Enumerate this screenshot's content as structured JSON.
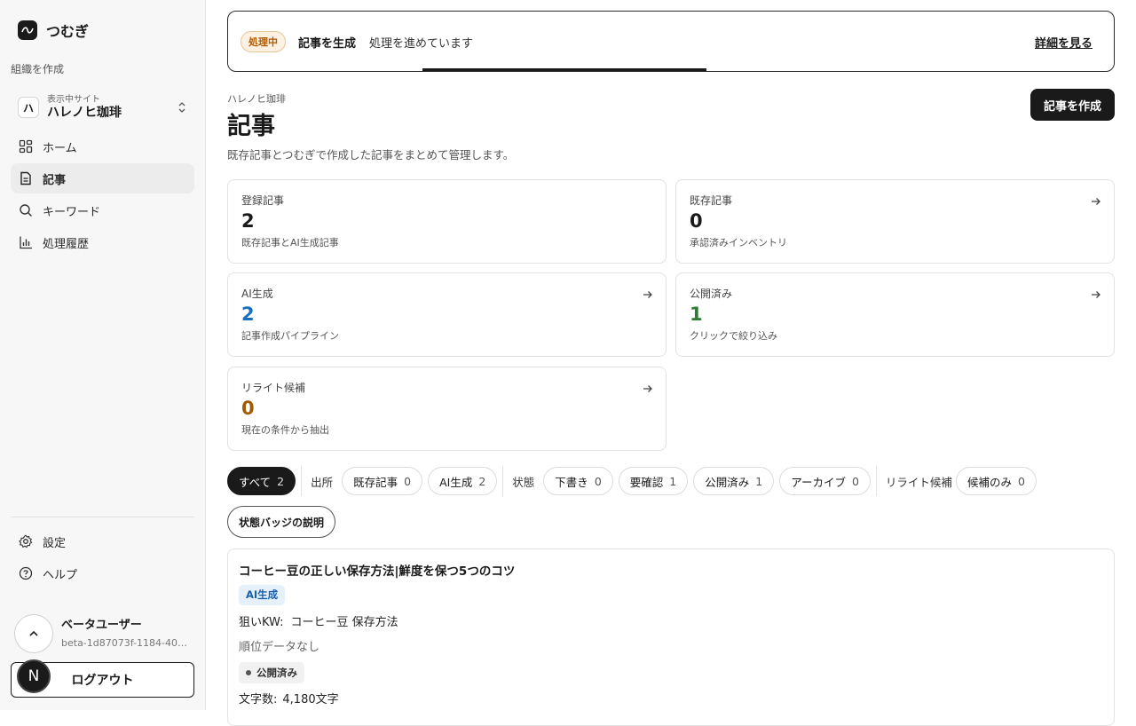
{
  "app": {
    "name": "つむぎ"
  },
  "sidebar": {
    "org_create": "組織を作成",
    "site": {
      "initial": "ハ",
      "sub": "表示中サイト",
      "name": "ハレノヒ珈琲"
    },
    "nav": [
      {
        "label": "ホーム",
        "icon": "grid-icon",
        "active": false
      },
      {
        "label": "記事",
        "icon": "document-icon",
        "active": true
      },
      {
        "label": "キーワード",
        "icon": "search-icon",
        "active": false
      },
      {
        "label": "処理履歴",
        "icon": "chart-icon",
        "active": false
      }
    ],
    "bottom": [
      {
        "label": "設定",
        "icon": "gear-icon"
      },
      {
        "label": "ヘルプ",
        "icon": "help-icon"
      }
    ],
    "user": {
      "name": "ベータユーザー",
      "id": "beta-1d87073f-1184-401...",
      "avatar": "N"
    },
    "logout": "ログアウト"
  },
  "banner": {
    "status": "処理中",
    "title": "記事を生成",
    "message": "処理を進めています",
    "link": "詳細を見る"
  },
  "header": {
    "breadcrumb": "ハレノヒ珈琲",
    "title": "記事",
    "description": "既存記事とつむぎで作成した記事をまとめて管理します。",
    "create_button": "記事を作成"
  },
  "stats": [
    {
      "label": "登録記事",
      "value": "2",
      "desc": "既存記事とAI生成記事",
      "color": "#1a1a1a",
      "arrow": false
    },
    {
      "label": "既存記事",
      "value": "0",
      "desc": "承認済みインベントリ",
      "color": "#1a1a1a",
      "arrow": true
    },
    {
      "label": "AI生成",
      "value": "2",
      "desc": "記事作成パイプライン",
      "color": "#1b6fbf",
      "arrow": true
    },
    {
      "label": "公開済み",
      "value": "1",
      "desc": "クリックで絞り込み",
      "color": "#2e7d32",
      "arrow": true
    },
    {
      "label": "リライト候補",
      "value": "0",
      "desc": "現在の条件から抽出",
      "color": "#a05c00",
      "arrow": true
    }
  ],
  "filters": {
    "all": {
      "label": "すべて",
      "count": "2"
    },
    "source_label": "出所",
    "source": [
      {
        "label": "既存記事",
        "count": "0"
      },
      {
        "label": "AI生成",
        "count": "2"
      }
    ],
    "status_label": "状態",
    "status": [
      {
        "label": "下書き",
        "count": "0"
      },
      {
        "label": "要確認",
        "count": "1"
      },
      {
        "label": "公開済み",
        "count": "1"
      },
      {
        "label": "アーカイブ",
        "count": "0"
      }
    ],
    "rewrite_label": "リライト候補",
    "rewrite": [
      {
        "label": "候補のみ",
        "count": "0"
      }
    ]
  },
  "legend_button": "状態バッジの説明",
  "article": {
    "title": "コーヒー豆の正しい保存方法|鮮度を保つ5つのコツ",
    "badge": "AI生成",
    "kw_label": "狙いKW:",
    "kw_value": "コーヒー豆 保存方法",
    "rank": "順位データなし",
    "status": "公開済み",
    "wc_label": "文字数:",
    "wc_value": "4,180文字"
  }
}
